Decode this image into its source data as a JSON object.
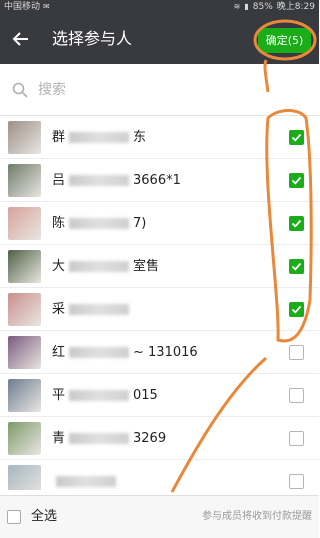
{
  "status_bar": {
    "carrier": "中国移动",
    "battery": "85%",
    "time": "晚上8:29"
  },
  "header": {
    "title": "选择参与人",
    "confirm_label": "确定(5)"
  },
  "search": {
    "placeholder": "搜索"
  },
  "contacts": [
    {
      "name": "群",
      "extra": "东",
      "checked": true,
      "avatar_color": "#9c8f86"
    },
    {
      "name": "吕",
      "extra": "3666*1",
      "checked": true,
      "avatar_color": "#6f7b6a"
    },
    {
      "name": "陈",
      "extra": "7)",
      "checked": true,
      "avatar_color": "#d6a39a"
    },
    {
      "name": "大",
      "extra": "室售",
      "checked": true,
      "avatar_color": "#4f6145"
    },
    {
      "name": "采",
      "extra": "",
      "checked": true,
      "avatar_color": "#c98f8c"
    },
    {
      "name": "红",
      "extra": "~ 131016",
      "checked": false,
      "avatar_color": "#7a5a7d"
    },
    {
      "name": "平",
      "extra": "015",
      "checked": false,
      "avatar_color": "#6d7d8f"
    },
    {
      "name": "青",
      "extra": "3269",
      "checked": false,
      "avatar_color": "#7e9a6a"
    },
    {
      "name": "",
      "extra": "",
      "checked": false,
      "avatar_color": "#a7b6c0"
    }
  ],
  "bottom": {
    "select_all_label": "全选",
    "hint": "参与成员将收到付款提醒"
  },
  "colors": {
    "header_bg": "#393a3f",
    "accent_green": "#1aad19",
    "annotation_orange": "#e8883a"
  }
}
